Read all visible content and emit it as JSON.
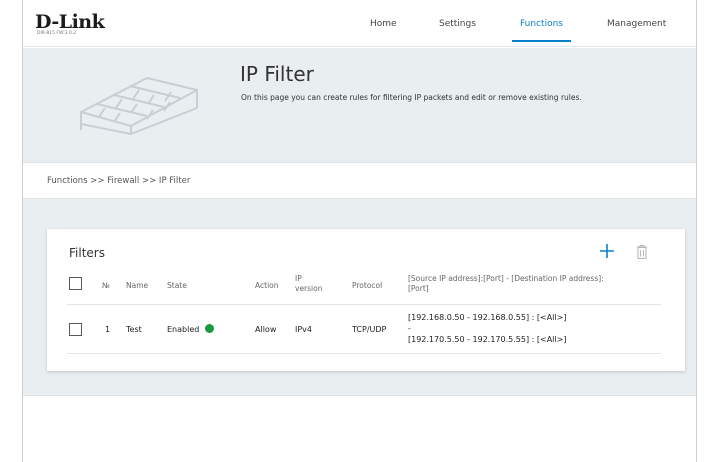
{
  "header": {
    "logo": "D-Link",
    "firmware": "DIR-815 FW:3.0.2",
    "nav": [
      "Home",
      "Settings",
      "Functions",
      "Management"
    ],
    "active_nav": "Functions"
  },
  "banner": {
    "title": "IP Filter",
    "description": "On this page you can create rules for filtering IP packets and edit or remove existing rules."
  },
  "breadcrumb": "Functions >> Firewall >> IP Filter",
  "filters": {
    "title": "Filters",
    "columns": {
      "number": "№",
      "name": "Name",
      "state": "State",
      "action": "Action",
      "ip_version_1": "IP",
      "ip_version_2": "version",
      "protocol": "Protocol",
      "rule_1": "[Source IP address]:[Port] - [Destination IP address]:",
      "rule_2": "[Port]"
    },
    "rows": [
      {
        "number": "1",
        "name": "Test",
        "state": "Enabled",
        "state_color": "#1a9a3c",
        "action": "Allow",
        "ip_version": "IPv4",
        "protocol": "TCP/UDP",
        "rule_line1": "[192.168.0.50 - 192.168.0.55] : [<All>]",
        "rule_line2": "-",
        "rule_line3": "[192.170.5.50 - 192.170.5.55] : [<All>]"
      }
    ]
  },
  "colors": {
    "accent": "#0a80c8",
    "enabled": "#1a9a3c",
    "banner_bg": "#e9eef1"
  }
}
